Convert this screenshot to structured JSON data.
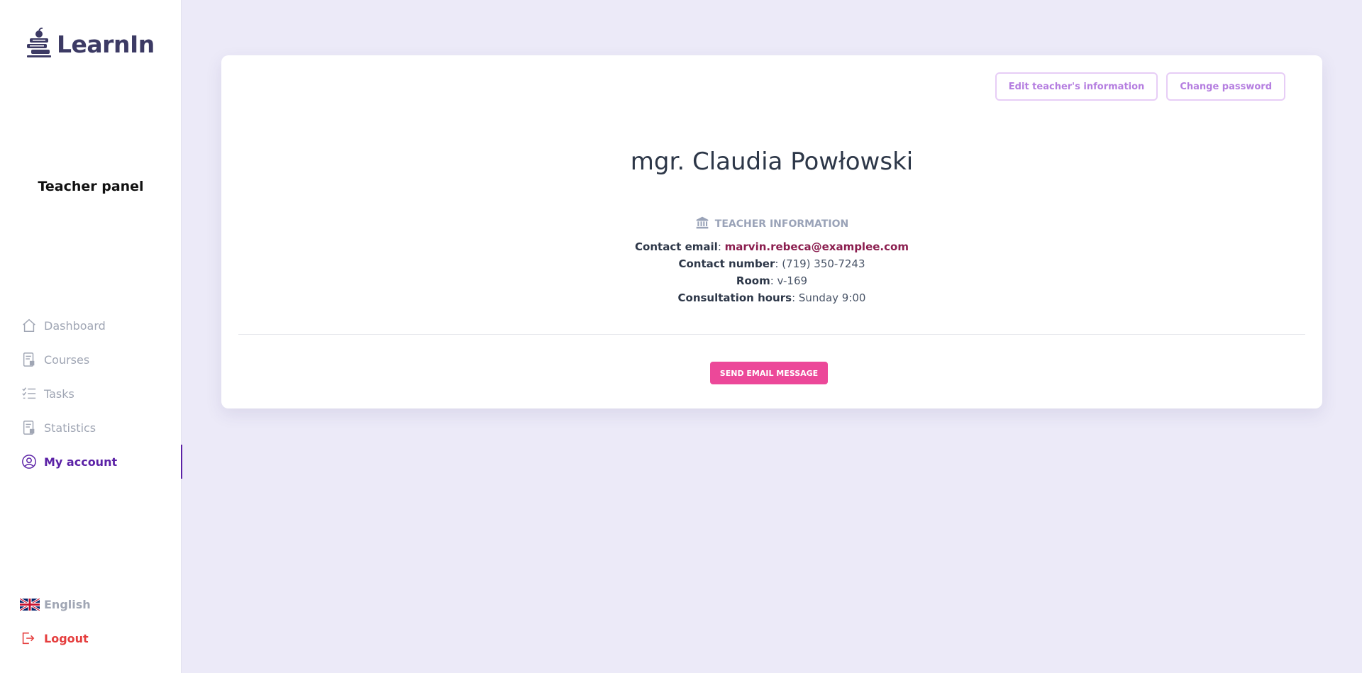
{
  "app": {
    "logo_text": "LearnIn",
    "panel_title": "Teacher panel"
  },
  "sidebar": {
    "items": [
      {
        "label": "Dashboard",
        "icon": "home-icon"
      },
      {
        "label": "Courses",
        "icon": "document-icon"
      },
      {
        "label": "Tasks",
        "icon": "checklist-icon"
      },
      {
        "label": "Statistics",
        "icon": "document-chart-icon"
      },
      {
        "label": "My account",
        "icon": "user-circle-icon",
        "active": true
      }
    ],
    "language": {
      "label": "English",
      "icon": "uk-flag-icon"
    },
    "logout": {
      "label": "Logout",
      "icon": "logout-icon"
    }
  },
  "profile": {
    "edit_button": "Edit teacher's information",
    "password_button": "Change password",
    "name": "mgr. Claudia Powłowski",
    "section_title": "TEACHER INFORMATION",
    "email_label": "Contact email",
    "email_value": "marvin.rebeca@examplee.com",
    "phone_label": "Contact number",
    "phone_value": "(719) 350-7243",
    "room_label": "Room",
    "room_value": "v-169",
    "hours_label": "Consultation hours",
    "hours_value": "Sunday 9:00",
    "send_button": "SEND EMAIL MESSAGE"
  },
  "colors": {
    "accent": "#5b21a6",
    "pink": "#ec4899",
    "logout": "#e53e3e",
    "background": "#eceaf8"
  }
}
